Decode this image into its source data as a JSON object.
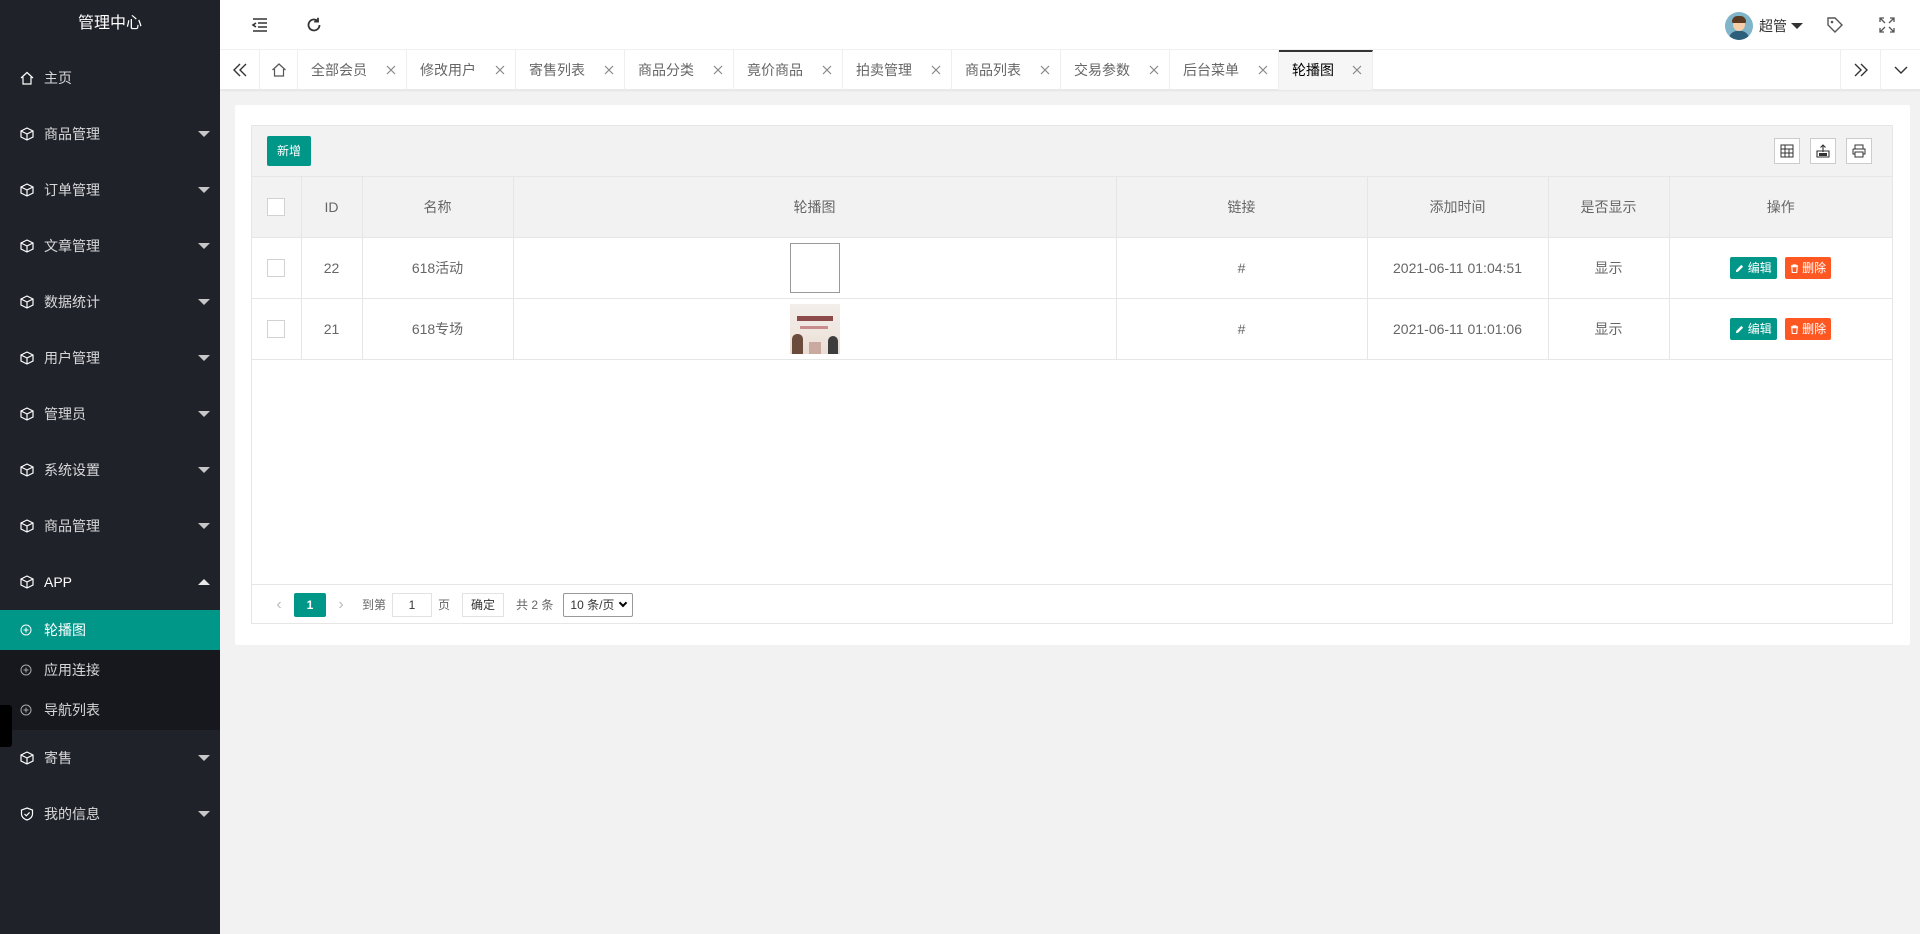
{
  "app": {
    "title": "管理中心"
  },
  "sidebar": {
    "items": [
      {
        "label": "主页",
        "icon": "home-icon"
      },
      {
        "label": "商品管理",
        "icon": "cube-icon"
      },
      {
        "label": "订单管理",
        "icon": "cube-icon"
      },
      {
        "label": "文章管理",
        "icon": "cube-icon"
      },
      {
        "label": "数据统计",
        "icon": "cube-icon"
      },
      {
        "label": "用户管理",
        "icon": "cube-icon"
      },
      {
        "label": "管理员",
        "icon": "cube-icon"
      },
      {
        "label": "系统设置",
        "icon": "cube-icon"
      },
      {
        "label": "商品管理",
        "icon": "cube-icon"
      },
      {
        "label": "APP",
        "icon": "cube-icon",
        "expanded": true,
        "children": [
          {
            "label": "轮播图",
            "active": true
          },
          {
            "label": "应用连接"
          },
          {
            "label": "导航列表"
          }
        ]
      },
      {
        "label": "寄售",
        "icon": "cube-icon"
      },
      {
        "label": "我的信息",
        "icon": "shield-icon"
      }
    ]
  },
  "header": {
    "user_name": "超管"
  },
  "tabs": [
    {
      "label": "全部会员"
    },
    {
      "label": "修改用户"
    },
    {
      "label": "寄售列表"
    },
    {
      "label": "商品分类"
    },
    {
      "label": "竟价商品"
    },
    {
      "label": "拍卖管理"
    },
    {
      "label": "商品列表"
    },
    {
      "label": "交易参数"
    },
    {
      "label": "后台菜单"
    },
    {
      "label": "轮播图",
      "active": true
    }
  ],
  "toolbar": {
    "add_label": "新增"
  },
  "table": {
    "columns": [
      "ID",
      "名称",
      "轮播图",
      "链接",
      "添加时间",
      "是否显示",
      "操作"
    ],
    "rows": [
      {
        "id": "22",
        "name": "618活动",
        "link": "#",
        "time": "2021-06-11 01:04:51",
        "show": "显示",
        "edit": "编辑",
        "del": "删除"
      },
      {
        "id": "21",
        "name": "618专场",
        "link": "#",
        "time": "2021-06-11 01:01:06",
        "show": "显示",
        "edit": "编辑",
        "del": "删除"
      }
    ]
  },
  "pager": {
    "current": "1",
    "goto_label": "到第",
    "goto_value": "1",
    "page_label": "页",
    "confirm_label": "确定",
    "total_label": "共 2 条",
    "page_size": "10 条/页"
  },
  "colors": {
    "sidebar_bg": "#20222a",
    "accent": "#009688",
    "danger": "#ff5722"
  }
}
